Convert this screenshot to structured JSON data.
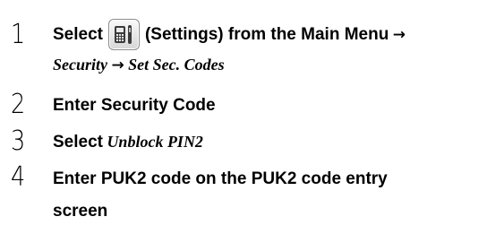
{
  "steps": [
    {
      "number": "1",
      "action": "Select",
      "icon": "settings-icon",
      "icon_caption": "(Settings) from the Main Menu",
      "arrow": "→",
      "menu_path": [
        "Security",
        "Set Sec. Codes"
      ]
    },
    {
      "number": "2",
      "text": "Enter Security Code"
    },
    {
      "number": "3",
      "action": "Select",
      "item": "Unblock PIN2"
    },
    {
      "number": "4",
      "line1": "Enter PUK2 code on the PUK2 code entry",
      "line2": "screen"
    }
  ]
}
